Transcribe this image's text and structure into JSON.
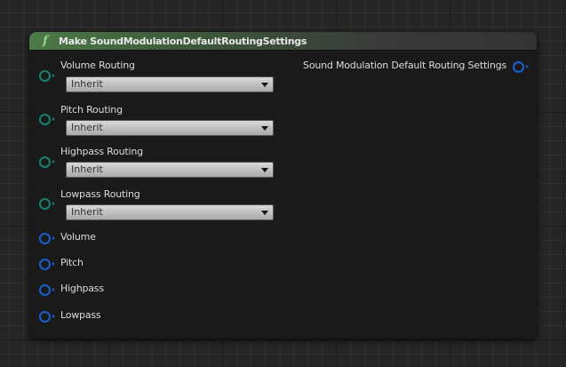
{
  "node": {
    "title": "Make SoundModulationDefaultRoutingSettings",
    "icon": "function-icon"
  },
  "inputs_enum": [
    {
      "label": "Volume Routing",
      "value": "Inherit"
    },
    {
      "label": "Pitch Routing",
      "value": "Inherit"
    },
    {
      "label": "Highpass Routing",
      "value": "Inherit"
    },
    {
      "label": "Lowpass Routing",
      "value": "Inherit"
    }
  ],
  "inputs_struct": [
    {
      "label": "Volume"
    },
    {
      "label": "Pitch"
    },
    {
      "label": "Highpass"
    },
    {
      "label": "Lowpass"
    }
  ],
  "output": {
    "label": "Sound Modulation Default Routing Settings"
  },
  "colors": {
    "enum_pin": "#138473",
    "struct_pin": "#1a5fd0",
    "header": "#4d7a48"
  }
}
